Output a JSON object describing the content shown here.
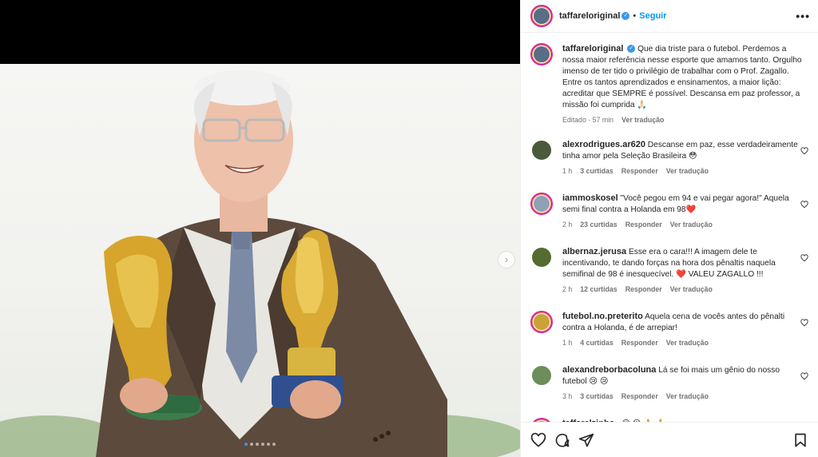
{
  "post": {
    "author": "taffareloriginal",
    "follow_label": "Seguir",
    "separator": "•",
    "more_label": "•••",
    "caption": "Que dia triste para o futebol. Perdemos a nossa maior referência nesse esporte que amamos tanto. Orgulho imenso de ter tido o privilégio de trabalhar com o Prof. Zagallo. Entre os tantos aprendizados e ensinamentos, a maior lição: acreditar que SEMPRE é possível. Descansa em paz professor, a missão foi cumprida 🙏🏻",
    "edited_label": "Editado · 57 min",
    "translate_label": "Ver tradução"
  },
  "carousel": {
    "total": 6,
    "active_index": 0,
    "next_label": "›"
  },
  "comments": [
    {
      "user": "alexrodrigues.ar620",
      "text": "Descanse em paz, esse verdadeiramente tinha amor pela Seleção Brasileira 😳",
      "time": "1 h",
      "likes": "3 curtidas",
      "reply": "Responder",
      "translate": "Ver tradução",
      "avatar_color": "#4a5a3a"
    },
    {
      "user": "iammoskosel",
      "text": "\"Você pegou em 94 e vai pegar agora!\" Aquela semi final contra a Holanda em 98❤️",
      "time": "2 h",
      "likes": "23 curtidas",
      "reply": "Responder",
      "translate": "Ver tradução",
      "avatar_color": "#8fa1b6"
    },
    {
      "user": "albernaz.jerusa",
      "text": "Esse era o cara!!! A imagem dele te incentivando, te dando forças na hora dos pênaltis naquela semifinal de 98 é inesquecível. ❤️ VALEU ZAGALLO !!!",
      "time": "2 h",
      "likes": "12 curtidas",
      "reply": "Responder",
      "translate": "Ver tradução",
      "avatar_color": "#556b2f"
    },
    {
      "user": "futebol.no.preterito",
      "text": "Aquela cena de vocês antes do pênalti contra a Holanda, é de arrepiar!",
      "time": "1 h",
      "likes": "4 curtidas",
      "reply": "Responder",
      "translate": "Ver tradução",
      "avatar_color": "#c9a23a"
    },
    {
      "user": "alexandreborbacoluna",
      "text": "Lá se foi mais um gênio do nosso futebol 😢 😢",
      "time": "3 h",
      "likes": "3 curtidas",
      "reply": "Responder",
      "translate": "Ver tradução",
      "avatar_color": "#6b8e5a"
    },
    {
      "user": "taffarelzinho_",
      "text": "😢 😢 🙏 🙏",
      "time": "",
      "likes": "",
      "reply": "",
      "translate": "",
      "avatar_color": "#7a8fb0"
    }
  ],
  "icons": {
    "like": "heart-icon",
    "comment": "comment-icon",
    "share": "share-icon",
    "save": "bookmark-icon"
  },
  "colors": {
    "link": "#0095f6",
    "verified": "#3897f0",
    "ring": "#d6249f",
    "heart_emoji": "#e0245e"
  }
}
